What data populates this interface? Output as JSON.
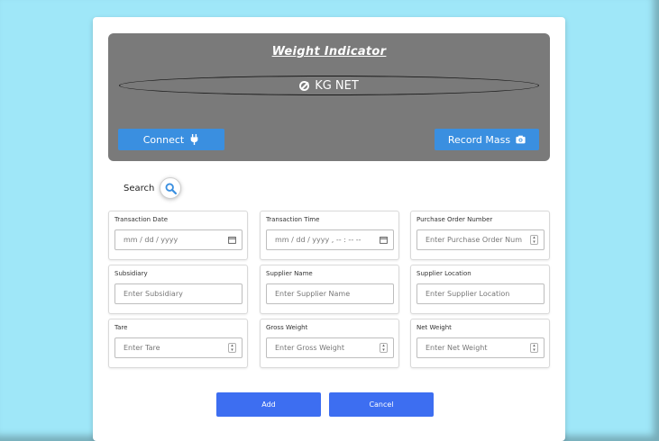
{
  "indicator": {
    "title": "Weight Indicator",
    "readout": "KG NET",
    "connect_label": "Connect",
    "record_label": "Record Mass"
  },
  "search": {
    "label": "Search"
  },
  "fields": [
    {
      "label": "Transaction Date",
      "placeholder": "mm / dd / yyyy",
      "trail": "calendar-icon"
    },
    {
      "label": "Transaction Time",
      "placeholder": "mm / dd / yyyy ,  -- : --   --",
      "trail": "calendar-icon"
    },
    {
      "label": "Purchase Order Number",
      "placeholder": "Enter Purchase Order Num",
      "trail": "spinner"
    },
    {
      "label": "Subsidiary",
      "placeholder": "Enter Subsidiary",
      "trail": ""
    },
    {
      "label": "Supplier Name",
      "placeholder": "Enter Supplier Name",
      "trail": ""
    },
    {
      "label": "Supplier Location",
      "placeholder": "Enter Supplier Location",
      "trail": ""
    },
    {
      "label": "Tare",
      "placeholder": "Enter Tare",
      "trail": "spinner"
    },
    {
      "label": "Gross Weight",
      "placeholder": "Enter Gross Weight",
      "trail": "spinner"
    },
    {
      "label": "Net Weight",
      "placeholder": "Enter Net Weight",
      "trail": "spinner"
    }
  ],
  "actions": {
    "add_label": "Add",
    "cancel_label": "Cancel"
  },
  "colors": {
    "background": "#9fe7f8",
    "indicator_panel": "#7a7a7a",
    "indicator_button": "#3a8fe0",
    "action_button": "#3d6ef1"
  }
}
